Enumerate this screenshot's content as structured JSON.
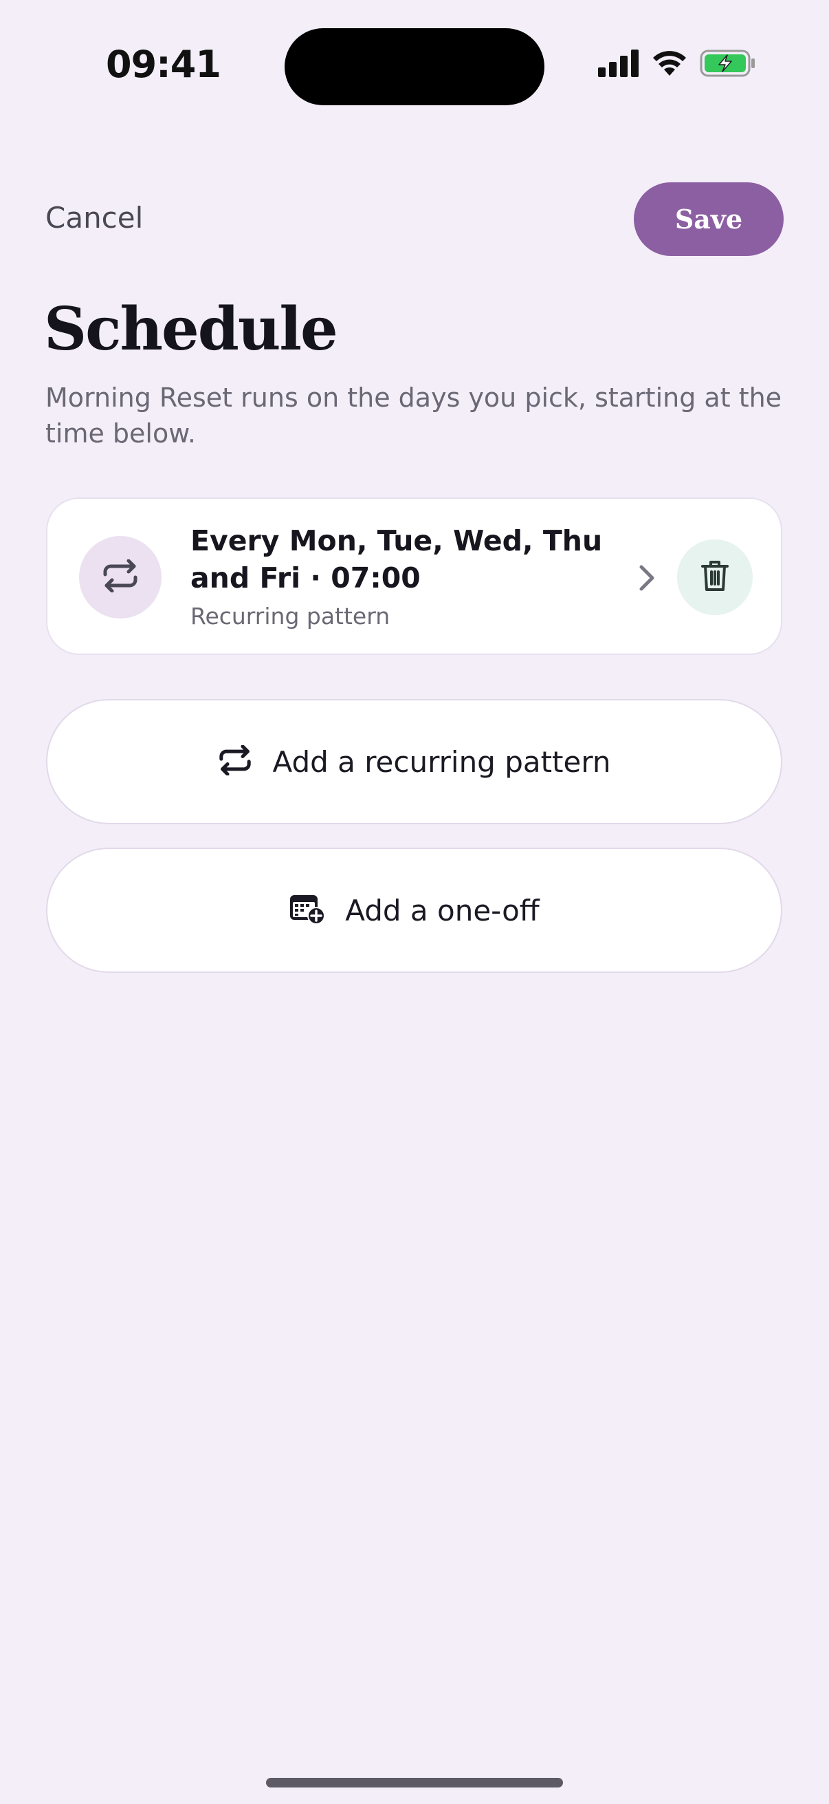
{
  "status_bar": {
    "time": "09:41",
    "icons": [
      "cellular-signal-icon",
      "wifi-icon",
      "battery-charging-icon"
    ]
  },
  "header": {
    "cancel_label": "Cancel",
    "save_label": "Save",
    "title": "Schedule",
    "subtitle": "Morning Reset runs on the days you pick, starting at the time below."
  },
  "schedule": {
    "title": "Every Mon, Tue, Wed, Thu and Fri · 07:00",
    "subtitle": "Recurring pattern",
    "icon": "repeat-icon"
  },
  "actions": {
    "add_recurring_label": "Add a recurring pattern",
    "add_one_off_label": "Add a one-off"
  },
  "colors": {
    "background": "#f3eef8",
    "accent": "#8c5fa3",
    "repeat_badge": "#ece1f0",
    "delete_badge": "#e6f3ee",
    "battery_green": "#34c759"
  }
}
